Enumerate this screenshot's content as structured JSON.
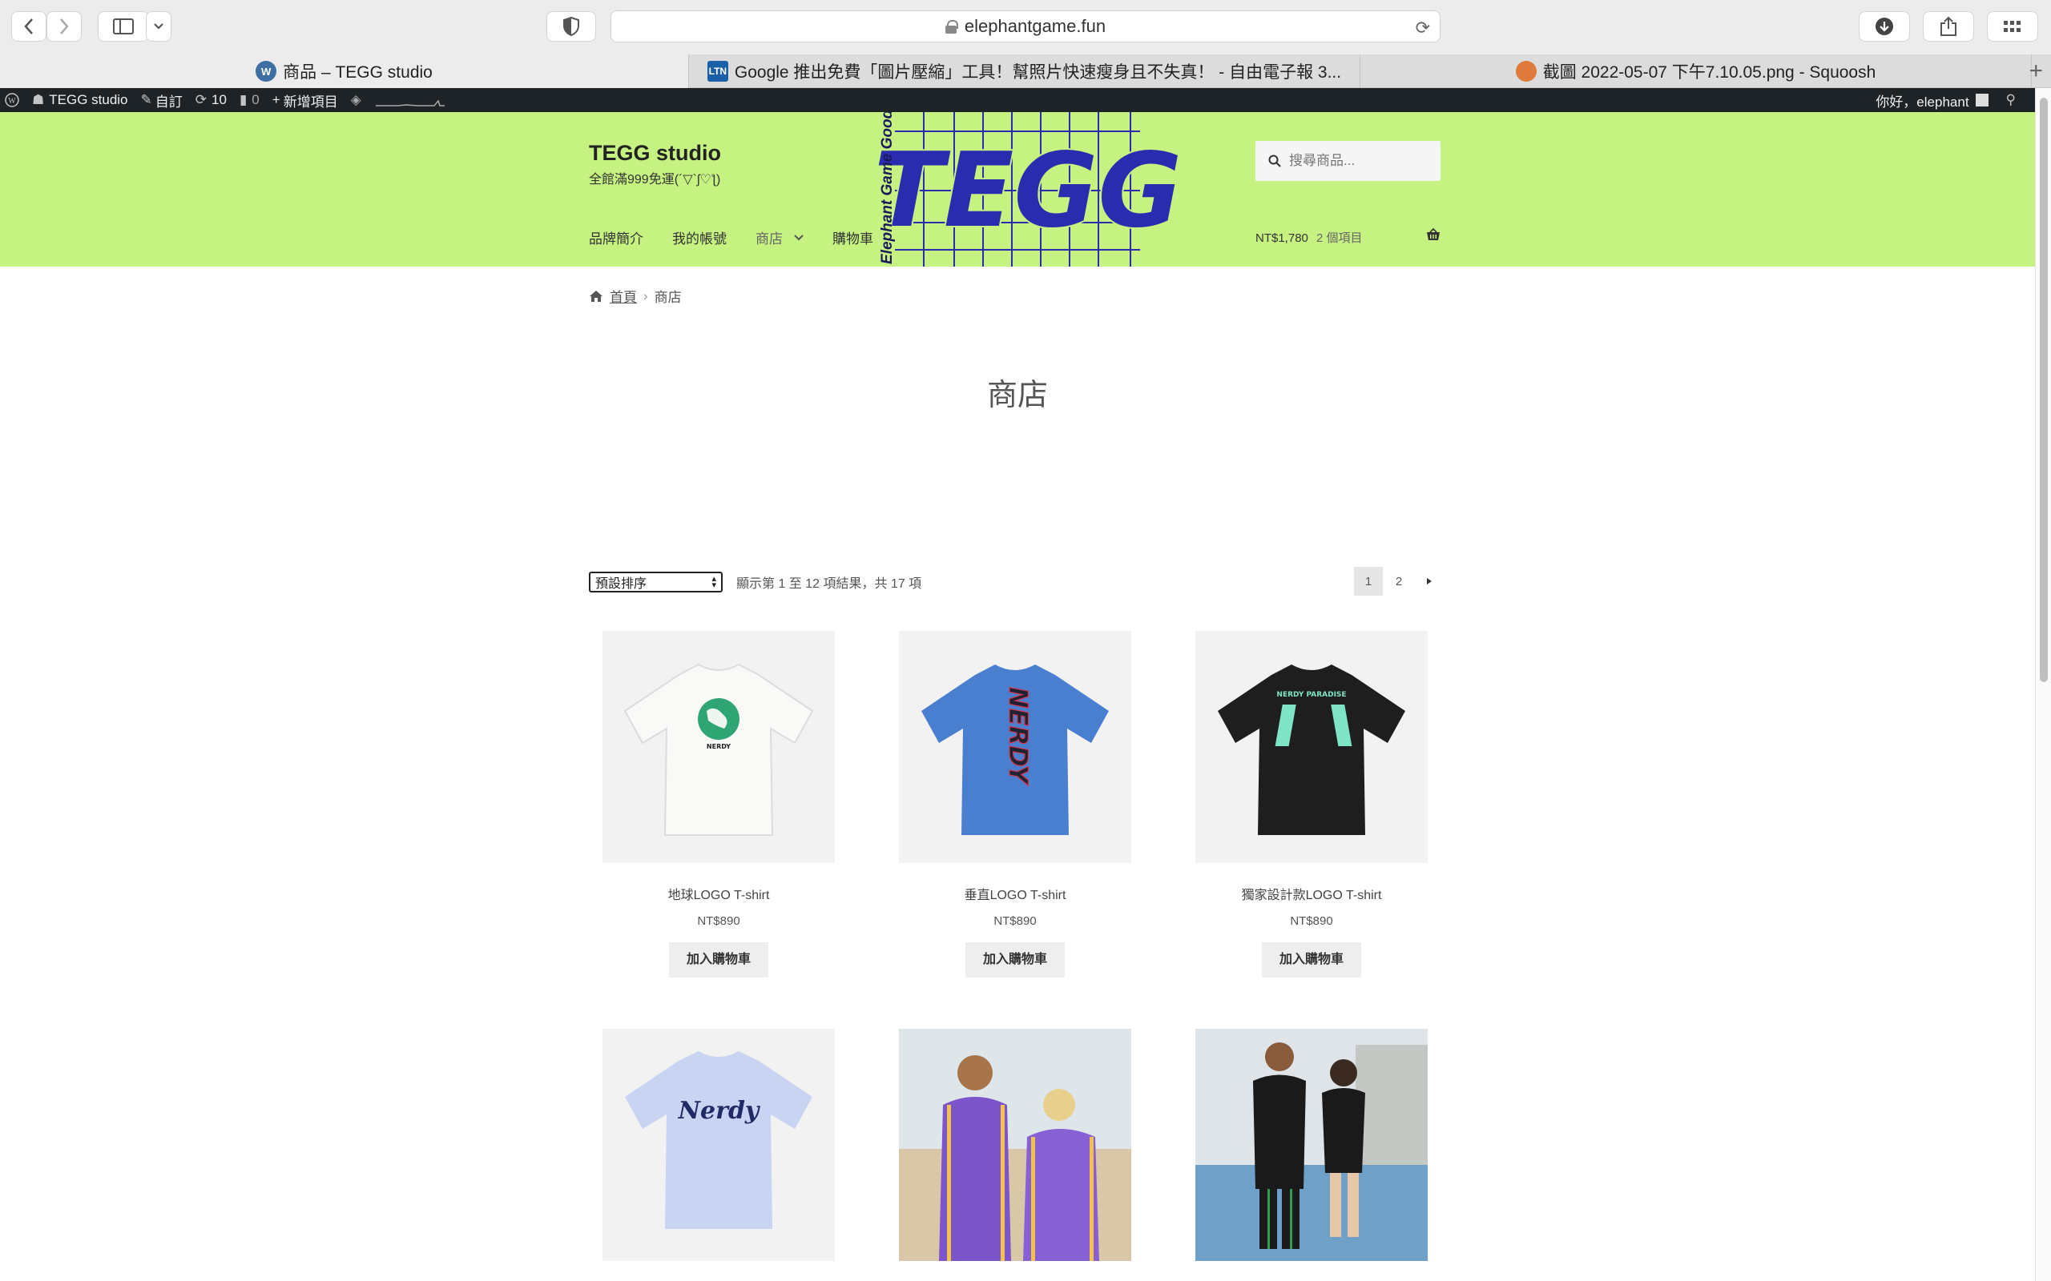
{
  "browser": {
    "url": "elephantgame.fun",
    "tabs": [
      {
        "title": "商品 – TEGG studio",
        "favicon": "wordpress-icon",
        "active": true
      },
      {
        "title": "Google 推出免費「圖片壓縮」工具！幫照片快速瘦身且不失真！ - 自由電子報 3...",
        "favicon": "ltn-icon",
        "favicon_text": "LTN",
        "active": false
      },
      {
        "title": "截圖 2022-05-07 下午7.10.05.png - Squoosh",
        "favicon": "squoosh-icon",
        "active": false
      }
    ]
  },
  "adminbar": {
    "site": "TEGG studio",
    "customize": "自訂",
    "updates": "10",
    "comments": "0",
    "new": "新增項目",
    "greeting": "你好，elephant"
  },
  "header": {
    "title": "TEGG studio",
    "tagline": "全館滿999免運(´▽`ʃ♡ƪ)",
    "nav": [
      {
        "label": "品牌簡介"
      },
      {
        "label": "我的帳號"
      },
      {
        "label": "商店",
        "has_submenu": true
      },
      {
        "label": "購物車"
      }
    ],
    "logo_text": "TEGG",
    "logo_sub": "Elephant Game Good",
    "search_placeholder": "搜尋商品...",
    "cart_total": "NT$1,780",
    "cart_count": "2 個項目"
  },
  "breadcrumb": {
    "home": "首頁",
    "current": "商店"
  },
  "page_title": "商店",
  "toolbar": {
    "sort_selected": "預設排序",
    "result_count": "顯示第 1 至 12 項結果，共 17 項",
    "pages": [
      "1",
      "2"
    ],
    "next": "→"
  },
  "products": [
    {
      "name": "地球LOGO T-shirt",
      "price": "NT$890",
      "button": "加入購物車",
      "shirt_color": "#f7f7f5",
      "print": "earth",
      "print_text": "NERDY"
    },
    {
      "name": "垂直LOGO T-shirt",
      "price": "NT$890",
      "button": "加入購物車",
      "shirt_color": "#4a7fcf",
      "print": "vertical",
      "print_text": "NERDY"
    },
    {
      "name": "獨家設計款LOGO T-shirt",
      "price": "NT$890",
      "button": "加入購物車",
      "shirt_color": "#1e1e1e",
      "print": "mint",
      "print_text": "NERDY PARADISE"
    },
    {
      "shirt_color": "#c9d3f2",
      "print": "script",
      "print_text": "Nerdy"
    },
    {
      "print": "photo-purple"
    },
    {
      "print": "photo-black"
    }
  ],
  "colors": {
    "header_bg": "#c5f281",
    "logo_blue": "#2b2bb0",
    "adminbar": "#1d2327"
  }
}
